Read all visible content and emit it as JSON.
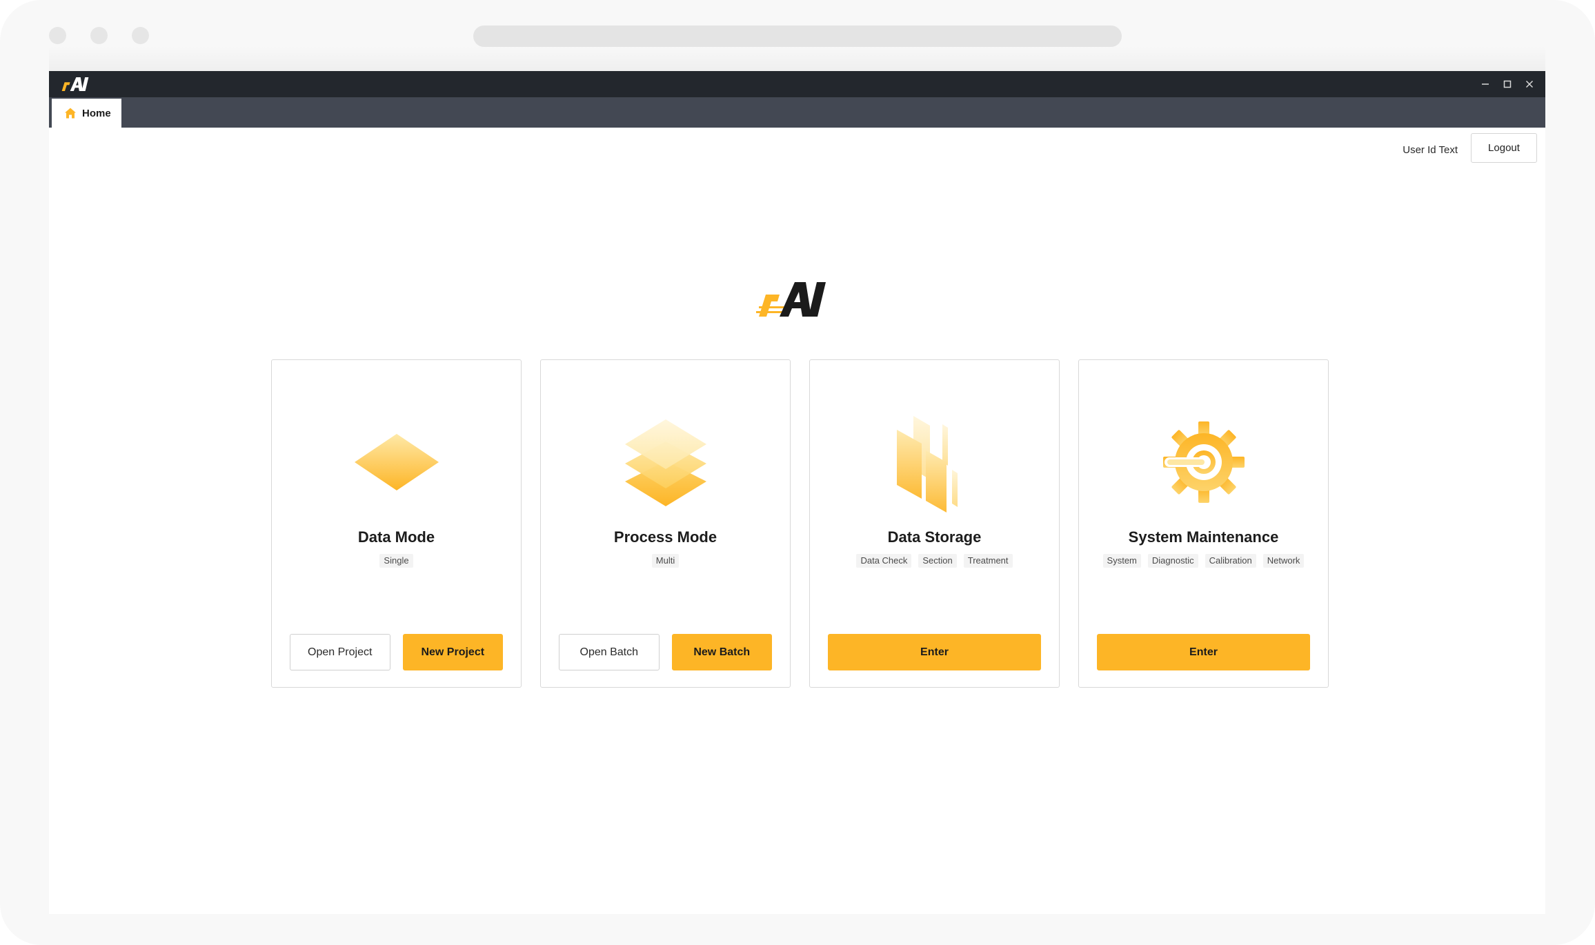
{
  "app": {
    "logo_text": "rAI"
  },
  "tabs": [
    {
      "label": "Home",
      "icon": "home-icon"
    }
  ],
  "header": {
    "user_id": "User Id Text",
    "logout_label": "Logout"
  },
  "colors": {
    "accent": "#fdb526",
    "titlebar": "#23272d",
    "tabbar": "#434853"
  },
  "cards": [
    {
      "title": "Data Mode",
      "icon": "diamond-icon",
      "tags": [
        "Single"
      ],
      "buttons": [
        {
          "label": "Open Project",
          "style": "outline"
        },
        {
          "label": "New Project",
          "style": "primary"
        }
      ]
    },
    {
      "title": "Process Mode",
      "icon": "layers-icon",
      "tags": [
        "Multi"
      ],
      "buttons": [
        {
          "label": "Open Batch",
          "style": "outline"
        },
        {
          "label": "New Batch",
          "style": "primary"
        }
      ]
    },
    {
      "title": "Data Storage",
      "icon": "storage-icon",
      "tags": [
        "Data Check",
        "Section",
        "Treatment"
      ],
      "buttons": [
        {
          "label": "Enter",
          "style": "primary"
        }
      ]
    },
    {
      "title": "System Maintenance",
      "icon": "gear-icon",
      "tags": [
        "System",
        "Diagnostic",
        "Calibration",
        "Network"
      ],
      "buttons": [
        {
          "label": "Enter",
          "style": "primary"
        }
      ]
    }
  ]
}
